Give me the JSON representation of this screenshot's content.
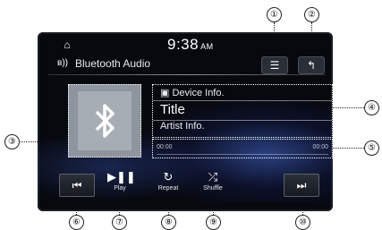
{
  "callouts": [
    "①",
    "②",
    "③",
    "④",
    "⑤",
    "⑥",
    "⑦",
    "⑧",
    "⑨",
    "⑩"
  ],
  "header": {
    "home_icon": "home-icon",
    "time": "9:38",
    "ampm": "AM",
    "source_icon": "bluetooth-audio-icon",
    "source_label": "Bluetooth Audio",
    "menu_glyph": "☰",
    "back_glyph": "↰"
  },
  "track": {
    "device_info": "Device Info.",
    "title": "Title",
    "artist": "Artist Info.",
    "elapsed": "00:00",
    "total": "00:00"
  },
  "controls": {
    "prev_glyph": "⏮",
    "play_glyph": "▶❚❚",
    "play_label": "Play",
    "repeat_glyph": "↻",
    "repeat_label": "Repeat",
    "shuffle_glyph": "⤮",
    "shuffle_label": "Shuffle",
    "next_glyph": "⏭"
  },
  "colors": {
    "screen_bg": "#07090f",
    "accent_glow": "#466edc",
    "album_bg": "#8f959e"
  }
}
